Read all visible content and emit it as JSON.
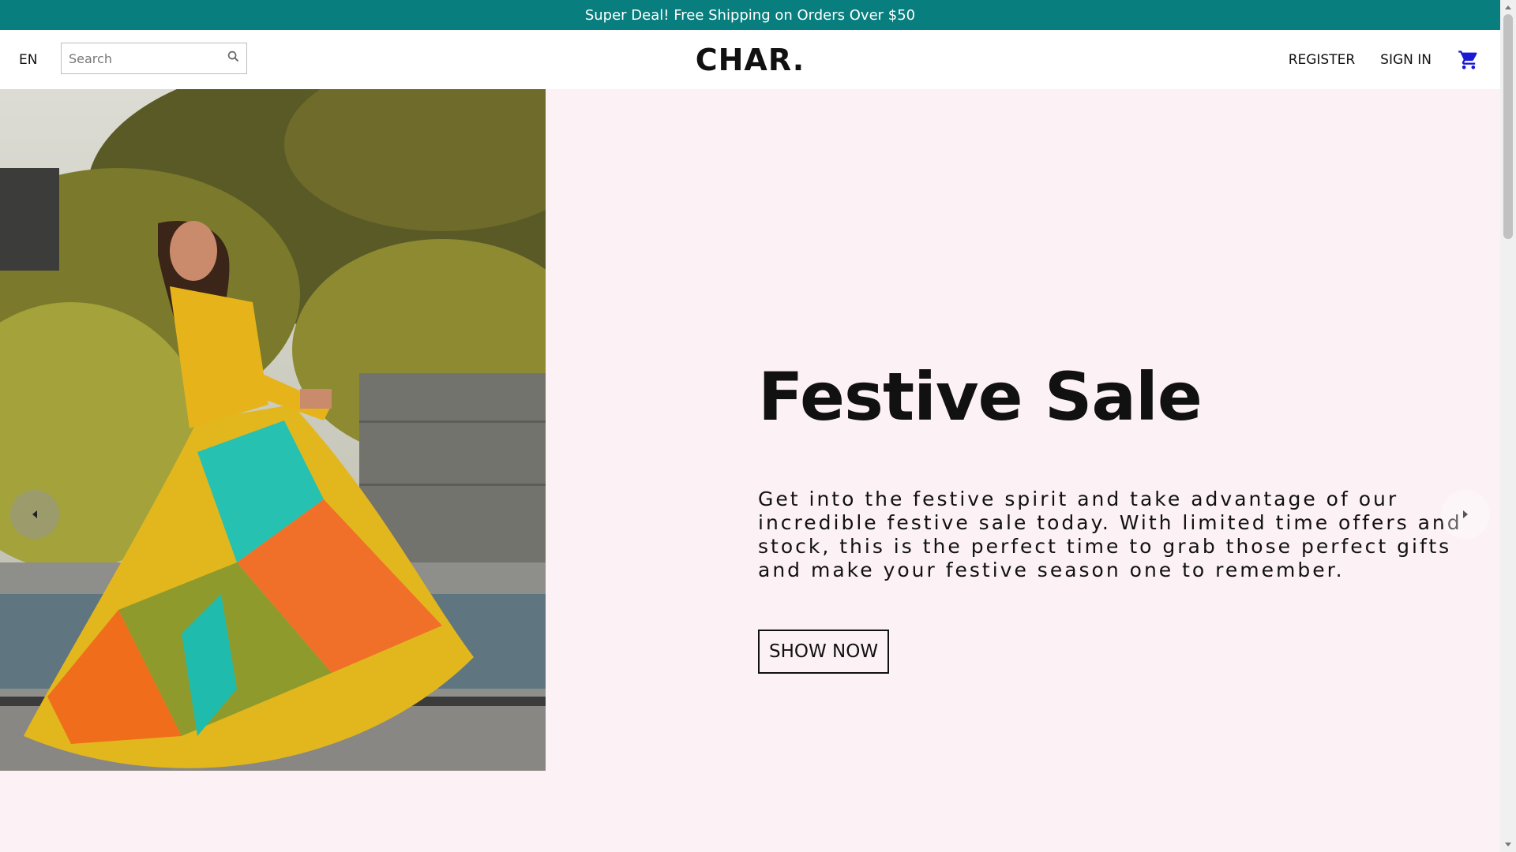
{
  "announcement": {
    "text": "Super Deal! Free Shipping on Orders Over $50"
  },
  "header": {
    "language": "EN",
    "search": {
      "placeholder": "Search",
      "value": ""
    },
    "logo": "CHAR.",
    "links": {
      "register": "REGISTER",
      "sign_in": "SIGN IN"
    },
    "icons": {
      "search": "search-icon",
      "cart": "cart-icon"
    },
    "cart_icon_color": "#1a1ad6"
  },
  "hero": {
    "title": "Festive Sale",
    "description": "Get into the festive spirit and take advantage of our incredible festive sale today. With limited time offers and stock, this is the perfect time to grab those perfect gifts and make your festive season one to remember.",
    "cta": "SHOW NOW",
    "background": "#fcf1f5",
    "icons": {
      "prev": "chevron-left-icon",
      "next": "chevron-right-icon"
    }
  },
  "colors": {
    "announcement_bg": "#087e7e",
    "text": "#111111"
  }
}
